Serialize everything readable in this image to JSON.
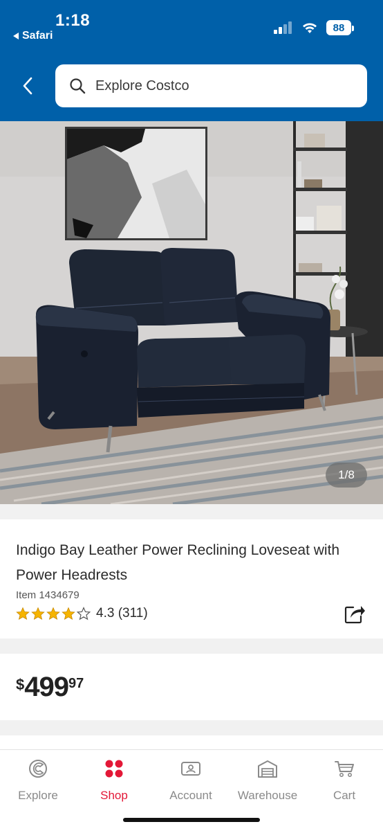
{
  "status_bar": {
    "time": "1:18",
    "back_app": "Safari",
    "battery": "88"
  },
  "header": {
    "back_icon": "chevron-left-icon",
    "search_placeholder": "Explore Costco",
    "accent_color": "#0060a9"
  },
  "gallery": {
    "counter": "1/8"
  },
  "product": {
    "title": "Indigo Bay Leather Power Reclining Loveseat with Power Headrests",
    "item_number": "Item 1434679",
    "rating_value": "4.3",
    "rating_count": "(311)",
    "stars": 4.3,
    "price_currency": "$",
    "price_dollars": "499",
    "price_cents": "97"
  },
  "tabbar": {
    "active_color": "#e31837",
    "tabs": [
      {
        "label": "Explore",
        "icon": "explore-icon"
      },
      {
        "label": "Shop",
        "icon": "shop-icon"
      },
      {
        "label": "Account",
        "icon": "account-icon"
      },
      {
        "label": "Warehouse",
        "icon": "warehouse-icon"
      },
      {
        "label": "Cart",
        "icon": "cart-icon"
      }
    ]
  }
}
